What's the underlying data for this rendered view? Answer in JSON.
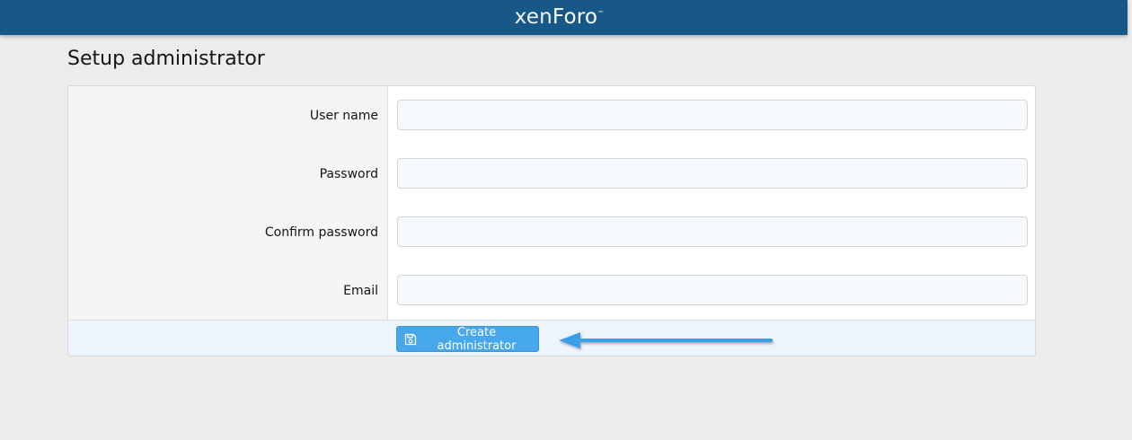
{
  "header": {
    "logo_xen": "xen",
    "logo_foro": "Foro",
    "logo_tm": "™",
    "background_color": "#185886"
  },
  "page": {
    "title": "Setup administrator"
  },
  "form": {
    "fields": [
      {
        "label": "User name",
        "value": "",
        "type": "text"
      },
      {
        "label": "Password",
        "value": "",
        "type": "password"
      },
      {
        "label": "Confirm password",
        "value": "",
        "type": "password"
      },
      {
        "label": "Email",
        "value": "",
        "type": "email"
      }
    ],
    "submit_label": "Create administrator",
    "submit_icon": "save-icon",
    "submit_color": "#47a7eb"
  },
  "annotation": {
    "arrow_color": "#3a9ee8"
  }
}
